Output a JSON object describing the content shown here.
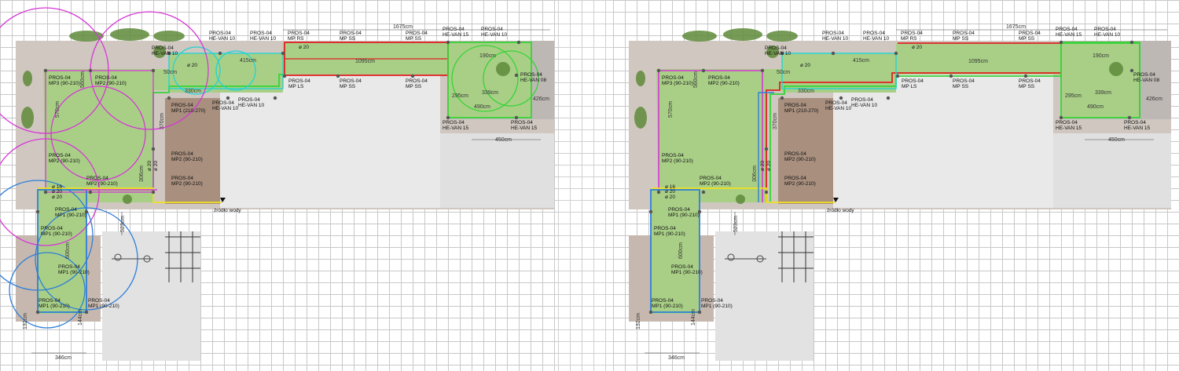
{
  "plans": [
    {
      "id": "left",
      "title_dim": "1675cm",
      "labels": {
        "l1": "PROS-04",
        "l1b": "HE-VAN 10",
        "l2": "PROS-04",
        "l2b": "HE-VAN 10",
        "l3": "PROS-04",
        "l3b": "MP RS",
        "l4": "PROS-04",
        "l4b": "MP SS",
        "l5": "PROS-04",
        "l5b": "MP SS",
        "l6": "PROS-04",
        "l6b": "HE-VAN 15",
        "l7": "PROS-04",
        "l7b": "HE-VAN 10",
        "l8": "PROS-04",
        "l8b": "HE-VAN 10",
        "l9": "PROS-04",
        "l9b": "MP3 (90-210)",
        "l10": "PROS-04",
        "l10b": "MP2 (90-210)",
        "l11": "PROS-04",
        "l11b": "MP LS",
        "l12": "PROS-04",
        "l12b": "MP SS",
        "l13": "PROS-04",
        "l13b": "MP SS",
        "l14": "PROS-04",
        "l14b": "HE-VAN 08",
        "l15": "PROS-04",
        "l15b": "HE-VAN 10",
        "l16": "PROS-04",
        "l16b": "HE-VAN 10",
        "l17": "PROS-04",
        "l17b": "MP1 (210-270)",
        "l18": "PROS-04",
        "l18b": "HE-VAN 15",
        "l19": "PROS-04",
        "l19b": "HE-VAN 15",
        "l20": "PROS-04",
        "l20b": "MP2 (90-210)",
        "l21": "PROS-04",
        "l21b": "MP2 (90-210)",
        "l22": "PROS-04",
        "l22b": "MP2 (90-210)",
        "l23": "PROS-04",
        "l23b": "MP2 (90-210)",
        "l24": "PROS-04",
        "l24b": "MP1 (90-210)",
        "l25": "PROS-04",
        "l25b": "MP1 (90-210)",
        "l26": "PROS-04",
        "l26b": "MP1 (90-210)",
        "l27": "PROS-04",
        "l27b": "MP1 (90-210)",
        "l28": "PROS-04",
        "l28b": "MP1 (90-210)"
      },
      "dims": {
        "d415": "415cm",
        "d1095": "1095cm",
        "d190": "190cm",
        "d295": "295cm",
        "d339": "339cm",
        "d490": "490cm",
        "d450": "450cm",
        "d426": "426cm",
        "d50": "50cm",
        "d330": "330cm",
        "d570": "570cm",
        "d370": "370cm",
        "d306": "306cm",
        "d523": "523cm",
        "d600": "600cm",
        "d346": "346cm",
        "d132": "132cm",
        "d144": "144cm",
        "d560": "560cm"
      },
      "pipes": {
        "p20a": "ø 20",
        "p20b": "ø 20",
        "p16": "ø 16",
        "p20c": "ø 20",
        "p20d": "ø 20",
        "p20e": "ø 20",
        "p20f": "ø 20"
      },
      "water": "źródło wody"
    },
    {
      "id": "right",
      "title_dim": "1675cm",
      "labels": {
        "l1": "PROS-04",
        "l1b": "HE-VAN 10",
        "l2": "PROS-04",
        "l2b": "HE-VAN 10",
        "l3": "PROS-04",
        "l3b": "MP RS",
        "l4": "PROS-04",
        "l4b": "MP SS",
        "l5": "PROS-04",
        "l5b": "MP SS",
        "l6": "PROS-04",
        "l6b": "HE-VAN 15",
        "l7": "PROS-04",
        "l7b": "HE-VAN 10",
        "l8": "PROS-04",
        "l8b": "HE-VAN 10",
        "l9": "PROS-04",
        "l9b": "MP3 (90-210)",
        "l10": "PROS-04",
        "l10b": "MP2 (90-210)",
        "l11": "PROS-04",
        "l11b": "MP LS",
        "l12": "PROS-04",
        "l12b": "MP SS",
        "l13": "PROS-04",
        "l13b": "MP SS",
        "l14": "PROS-04",
        "l14b": "HE-VAN 08",
        "l15": "PROS-04",
        "l15b": "HE-VAN 10",
        "l16": "PROS-04",
        "l16b": "HE-VAN 10",
        "l17": "PROS-04",
        "l17b": "MP1 (210-270)",
        "l18": "PROS-04",
        "l18b": "HE-VAN 15",
        "l19": "PROS-04",
        "l19b": "HE-VAN 15",
        "l20": "PROS-04",
        "l20b": "MP2 (90-210)",
        "l21": "PROS-04",
        "l21b": "MP2 (90-210)",
        "l22": "PROS-04",
        "l22b": "MP2 (90-210)",
        "l23": "PROS-04",
        "l23b": "MP2 (90-210)",
        "l24": "PROS-04",
        "l24b": "MP1 (90-210)",
        "l25": "PROS-04",
        "l25b": "MP1 (90-210)",
        "l26": "PROS-04",
        "l26b": "MP1 (90-210)",
        "l27": "PROS-04",
        "l27b": "MP1 (90-210)",
        "l28": "PROS-04",
        "l28b": "MP1 (90-210)"
      },
      "dims": {
        "d415": "415cm",
        "d1095": "1095cm",
        "d190": "190cm",
        "d295": "295cm",
        "d339": "339cm",
        "d490": "490cm",
        "d450": "450cm",
        "d426": "426cm",
        "d50": "50cm",
        "d330": "330cm",
        "d570": "570cm",
        "d370": "370cm",
        "d306": "306cm",
        "d523": "523cm",
        "d600": "600cm",
        "d346": "346cm",
        "d132": "132cm",
        "d144": "144cm",
        "d560": "560cm"
      },
      "pipes": {
        "p20a": "ø 20",
        "p20b": "ø 20",
        "p16": "ø 16",
        "p20c": "ø 20",
        "p20d": "ø 20",
        "p20e": "ø 20",
        "p20f": "ø 20"
      },
      "water": "źródło wody"
    }
  ],
  "colors": {
    "lawn": "#a9cf87",
    "paving": "#c9c9c9",
    "terrace": "#e6e6e6",
    "wood": "#a88f7e",
    "red_zone": "#e02020",
    "green_zone": "#36d436",
    "cyan_zone": "#22d3d3",
    "magenta_zone": "#d637d6",
    "blue_zone": "#2f7fd8",
    "yellow_pipe": "#f0e020"
  }
}
